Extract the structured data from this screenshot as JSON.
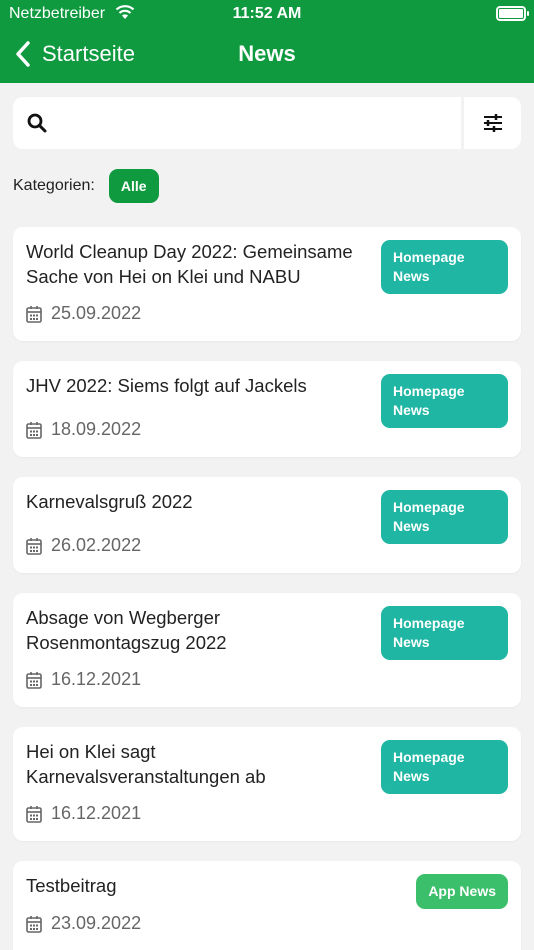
{
  "status_bar": {
    "carrier": "Netzbetreiber",
    "time": "11:52 AM"
  },
  "nav": {
    "back_label": "Startseite",
    "title": "News"
  },
  "search": {
    "placeholder": "",
    "value": ""
  },
  "filter": {
    "label": "Kategorien:",
    "active_chip": "Alle"
  },
  "colors": {
    "header_green": "#0f9a3f",
    "badge_teal": "#1fb6a4",
    "badge_green": "#3cbf6a"
  },
  "news": [
    {
      "title": "World Cleanup Day 2022: Gemeinsame Sache von Hei on Klei und NABU",
      "date": "25.09.2022",
      "category": "Homepage News"
    },
    {
      "title": "JHV 2022: Siems folgt auf Jackels",
      "date": "18.09.2022",
      "category": "Homepage News"
    },
    {
      "title": "Karnevalsgruß 2022",
      "date": "26.02.2022",
      "category": "Homepage News"
    },
    {
      "title": "Absage von Wegberger Rosenmontagszug 2022",
      "date": "16.12.2021",
      "category": "Homepage News"
    },
    {
      "title": "Hei on Klei sagt Karnevalsveranstaltungen ab",
      "date": "16.12.2021",
      "category": "Homepage News"
    },
    {
      "title": "Testbeitrag",
      "date": "23.09.2022",
      "category": "App News"
    }
  ]
}
